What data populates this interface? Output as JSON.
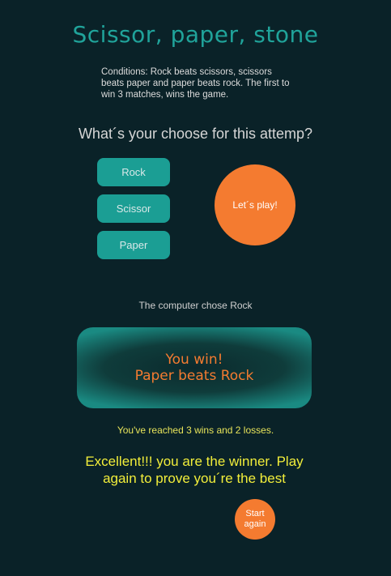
{
  "header": {
    "title": "Scissor, paper, stone",
    "conditions": "Conditions: Rock beats scissors, scissors beats paper and paper beats rock. The first to win 3 matches, wins the game."
  },
  "prompt": {
    "question": "What´s your choose for this attemp?"
  },
  "choices": [
    {
      "label": "Rock"
    },
    {
      "label": "Scissor"
    },
    {
      "label": "Paper"
    }
  ],
  "play_button": {
    "label": "Let´s play!"
  },
  "result": {
    "computer_choice": "The computer chose Rock",
    "line1": "You win!",
    "line2": "Paper beats Rock",
    "score": "You've reached 3 wins and 2 losses.",
    "final_message": "Excellent!!! you are the winner. Play again to prove you´re the best"
  },
  "restart_button": {
    "line1": "Start",
    "line2": "again"
  },
  "colors": {
    "background": "#0a2228",
    "teal": "#1b9e94",
    "orange": "#f47b30",
    "yellow": "#f2ee3a"
  }
}
